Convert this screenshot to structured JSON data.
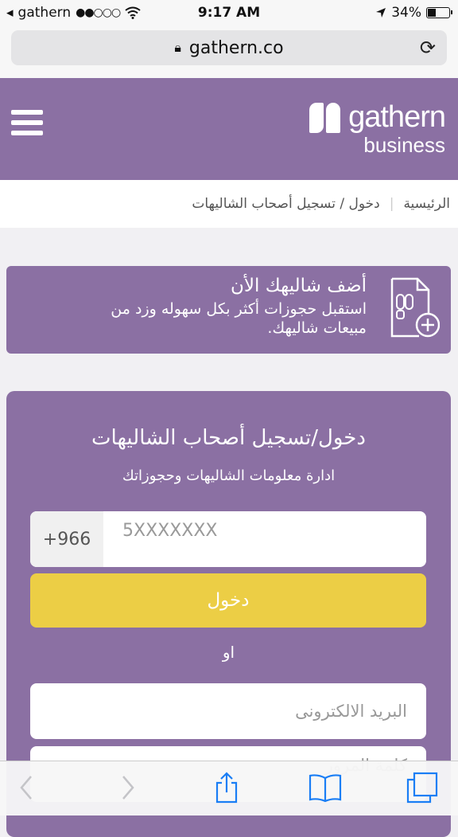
{
  "status": {
    "carrier": "gathern",
    "signal": "●●○○○",
    "time": "9:17 AM",
    "battery": "34%",
    "battery_level": 0.34
  },
  "browser": {
    "url": "gathern.co"
  },
  "header": {
    "logo_name": "gathern",
    "logo_sub": "business"
  },
  "breadcrumb": {
    "home": "الرئيسية",
    "current": "دخول / تسجيل أصحاب الشاليهات"
  },
  "promo": {
    "title": "أضف شاليهك الأن",
    "body": "استقبل حجوزات أكثر بكل سهوله وزد من مبيعات شاليهك."
  },
  "login": {
    "title": "دخول/تسجيل أصحاب الشاليهات",
    "subtitle": "ادارة معلومات الشاليهات وحجوزاتك",
    "country_code": "+966",
    "phone_placeholder": "5XXXXXXX",
    "login_button": "دخول",
    "or_text": "او",
    "email_placeholder": "البريد الالكترونى",
    "password_placeholder": "كلمة المرور"
  },
  "colors": {
    "brand": "#8b70a3",
    "login_button": "#ecce45"
  },
  "toolbar": {
    "icons": [
      "back-icon",
      "forward-icon",
      "share-icon",
      "bookmarks-icon",
      "tabs-icon"
    ]
  }
}
